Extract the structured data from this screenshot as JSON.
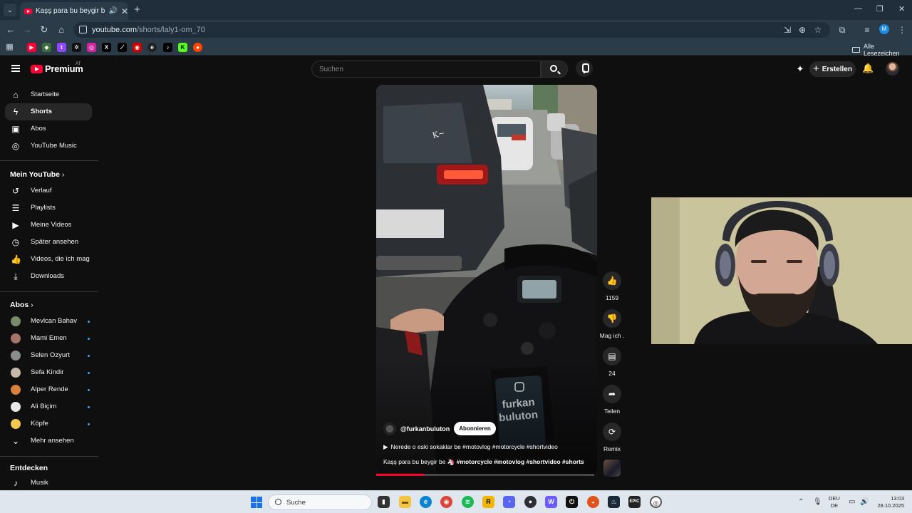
{
  "browser": {
    "tab_title": "Kaşş para bu beygir be 🦄",
    "url_domain": "youtube.com",
    "url_path": "/shorts/laly1-om_70",
    "bookmarks_all_label": "Alle Lesezeichen",
    "profile_initial": "M",
    "accent": "#1f2e3a"
  },
  "masthead": {
    "logo_text": "Premium",
    "country_code": "AT",
    "search_placeholder": "Suchen",
    "create_label": "Erstellen"
  },
  "sidebar": {
    "main": [
      {
        "label": "Startseite",
        "icon": "home-icon"
      },
      {
        "label": "Shorts",
        "icon": "shorts-icon"
      },
      {
        "label": "Abos",
        "icon": "subscriptions-icon"
      },
      {
        "label": "YouTube Music",
        "icon": "music-icon"
      }
    ],
    "you_header": "Mein YouTube",
    "you": [
      {
        "label": "Verlauf",
        "icon": "history-icon"
      },
      {
        "label": "Playlists",
        "icon": "playlists-icon"
      },
      {
        "label": "Meine Videos",
        "icon": "my-videos-icon"
      },
      {
        "label": "Später ansehen",
        "icon": "watch-later-icon"
      },
      {
        "label": "Videos, die ich mag",
        "icon": "liked-icon"
      },
      {
        "label": "Downloads",
        "icon": "download-icon"
      }
    ],
    "subs_header": "Abos",
    "subs": [
      {
        "label": "Mevlcan Bahav"
      },
      {
        "label": "Mami Emen"
      },
      {
        "label": "Selen Ozyurt"
      },
      {
        "label": "Sefa Kindir"
      },
      {
        "label": "Alper Rende"
      },
      {
        "label": "Ali Biçim"
      },
      {
        "label": "Köpfe"
      }
    ],
    "show_more": "Mehr ansehen",
    "explore_header": "Entdecken",
    "explore": [
      {
        "label": "Musik"
      }
    ]
  },
  "short": {
    "channel": "@furkanbuluton",
    "subscribe_label": "Abonnieren",
    "description": "Nerede o eski sokaklar be #motovlog #motorcycle #shortvideo",
    "title_plain": "Kaşş para bu beygir be 🦄 ",
    "title_tags": "#motorcycle #motovlog #shortvideo #shorts",
    "progress": 0.22,
    "overlay_text_1": "furkan",
    "overlay_text_2": "buluton"
  },
  "actions": {
    "like_count": "1159",
    "dislike_label": "Mag ich .",
    "comment_count": "24",
    "share_label": "Teilen",
    "remix_label": "Remix"
  },
  "taskbar": {
    "search_label": "Suche",
    "lang_1": "DEU",
    "lang_2": "DE",
    "time": "13:03",
    "date": "28.10.2025"
  }
}
